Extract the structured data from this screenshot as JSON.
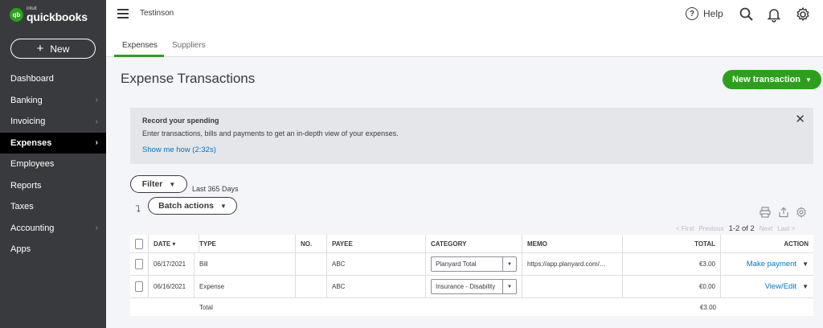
{
  "app": {
    "logo_badge": "qb",
    "logo_small": "intuit",
    "logo_name": "quickbooks",
    "brand_green": "#2ca01c",
    "link_blue": "#0077c5"
  },
  "sidebar": {
    "new_label": "New",
    "items": [
      {
        "label": "Dashboard",
        "has_chevron": false
      },
      {
        "label": "Banking",
        "has_chevron": true
      },
      {
        "label": "Invoicing",
        "has_chevron": true
      },
      {
        "label": "Expenses",
        "has_chevron": true,
        "active": true
      },
      {
        "label": "Employees",
        "has_chevron": false
      },
      {
        "label": "Reports",
        "has_chevron": false
      },
      {
        "label": "Taxes",
        "has_chevron": false
      },
      {
        "label": "Accounting",
        "has_chevron": true
      },
      {
        "label": "Apps",
        "has_chevron": false
      }
    ]
  },
  "topbar": {
    "company": "Testinson",
    "help_label": "Help",
    "icons": [
      "help-icon",
      "search-icon",
      "bell-icon",
      "gear-icon"
    ]
  },
  "tabs": [
    {
      "label": "Expenses",
      "active": true
    },
    {
      "label": "Suppliers",
      "active": false
    }
  ],
  "header": {
    "title": "Expense Transactions",
    "new_transaction": "New transaction"
  },
  "banner": {
    "title": "Record your spending",
    "body": "Enter transactions, bills and payments to get an in-depth view of your expenses.",
    "link": "Show me how (2:32s)"
  },
  "controls": {
    "filter_label": "Filter",
    "date_range": "Last 365 Days",
    "batch_label": "Batch actions",
    "pager": {
      "first": "< First",
      "previous": "Previous",
      "range": "1-2 of 2",
      "next": "Next",
      "last": "Last >"
    }
  },
  "table": {
    "columns": {
      "date": "DATE ▾",
      "type": "TYPE",
      "no": "NO.",
      "payee": "PAYEE",
      "category": "CATEGORY",
      "memo": "MEMO",
      "total": "TOTAL",
      "action": "ACTION"
    },
    "rows": [
      {
        "date": "06/17/2021",
        "type": "Bill",
        "no": "",
        "payee": "ABC",
        "category": "Planyard Total",
        "memo": "https://app.planyard.com/…",
        "total": "€3.00",
        "action": "Make payment"
      },
      {
        "date": "06/16/2021",
        "type": "Expense",
        "no": "",
        "payee": "ABC",
        "category": "Insurance - Disability",
        "memo": "",
        "total": "€0.00",
        "action": "View/Edit"
      }
    ],
    "footer": {
      "label": "Total",
      "total": "€3.00"
    }
  }
}
